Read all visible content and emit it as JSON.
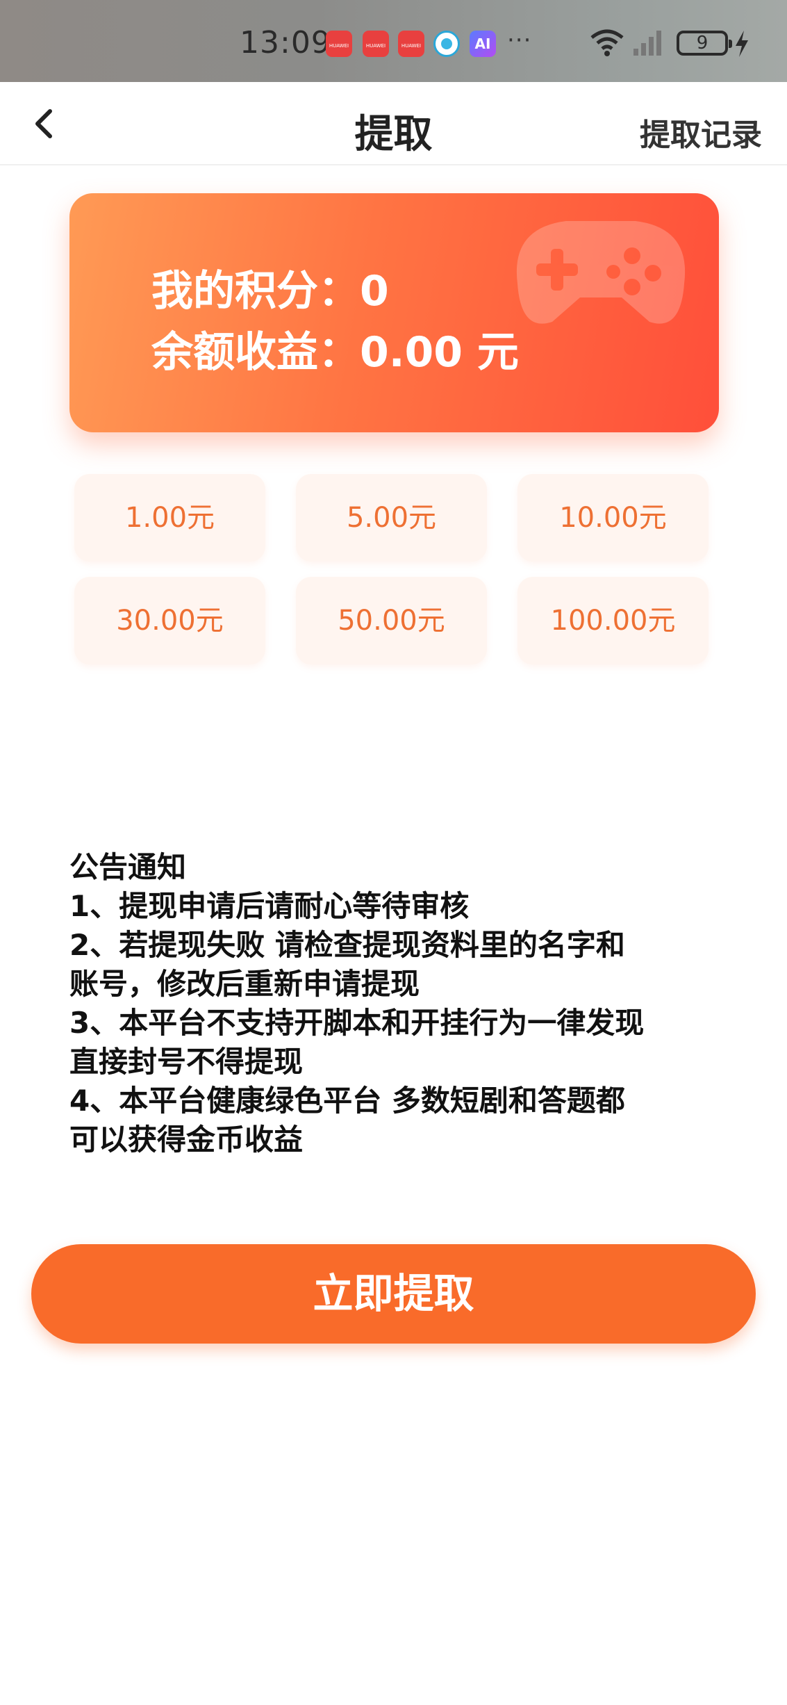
{
  "status_bar": {
    "time": "13:09",
    "app_icon_text": "HUAWEI",
    "ai_icon": "AI",
    "more": "···",
    "battery": "9"
  },
  "header": {
    "title": "提取",
    "record_link": "提取记录"
  },
  "balance_card": {
    "points_line": "我的积分：0",
    "balance_line": "余额收益：0.00 元"
  },
  "amounts": [
    "1.00元",
    "5.00元",
    "10.00元",
    "30.00元",
    "50.00元",
    "100.00元"
  ],
  "notice": {
    "lines": [
      "公告通知",
      "1、提现申请后请耐心等待审核",
      "2、若提现失败 请检查提现资料里的名字和",
      "账号，修改后重新申请提现",
      "3、本平台不支持开脚本和开挂行为一律发现",
      "直接封号不得提现",
      "4、本平台健康绿色平台 多数短剧和答题都",
      "可以获得金币收益"
    ]
  },
  "submit_label": "立即提取",
  "colors": {
    "accent": "#f96b2a",
    "card_start": "#ff9a55",
    "card_end": "#ff4f3a",
    "amount_text": "#ee7033",
    "amount_bg": "#fff5f0"
  },
  "icons": {
    "back": "chevron-left-icon",
    "card_decoration": "gamepad-icon",
    "wifi": "wifi-icon",
    "signal": "cellular-signal-icon",
    "battery": "battery-icon",
    "charging": "charging-bolt-icon"
  }
}
